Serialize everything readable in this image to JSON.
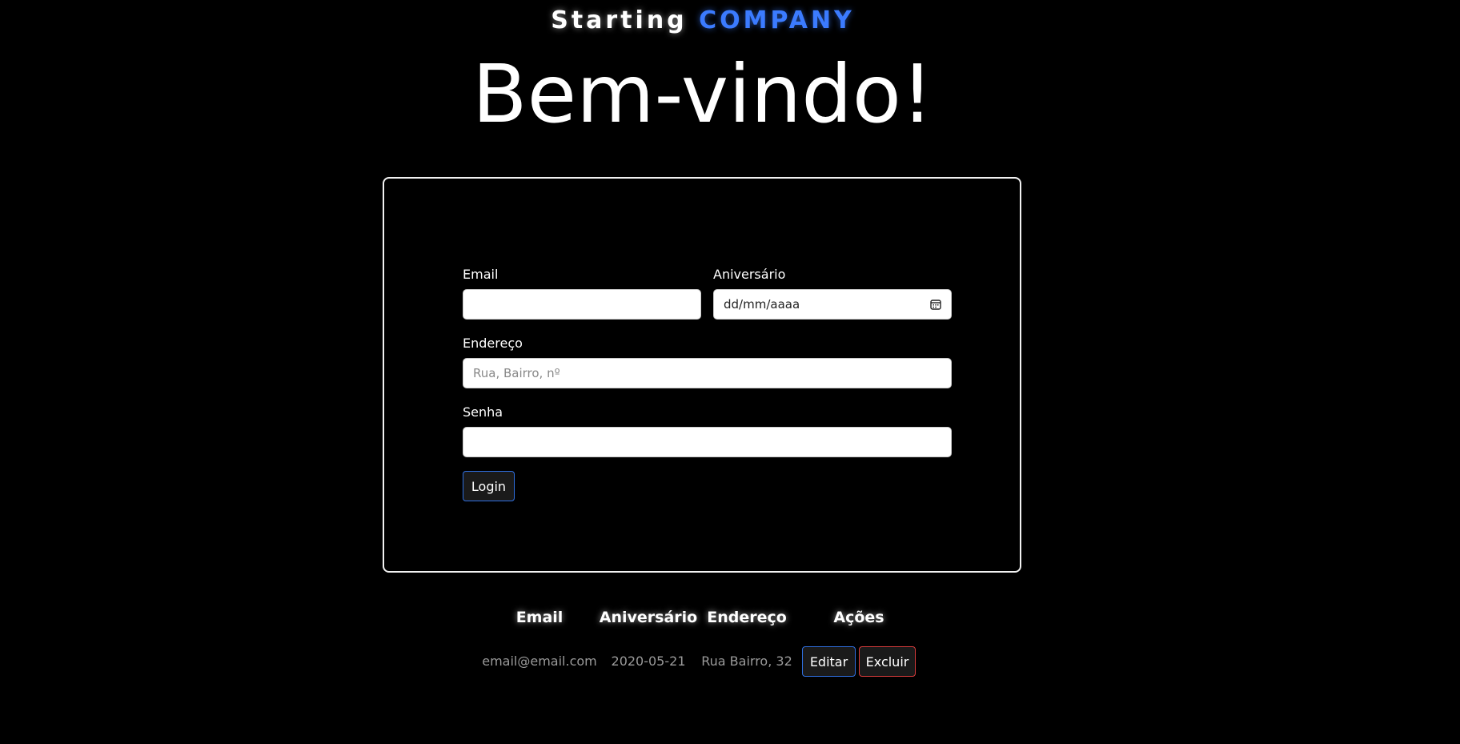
{
  "brand": {
    "word1": "Starting",
    "word2": "COMPANY",
    "accent_color": "#3b7bff"
  },
  "heading": "Bem-vindo!",
  "form": {
    "email": {
      "label": "Email",
      "value": ""
    },
    "birthday": {
      "label": "Aniversário",
      "placeholder": "dd/mm/aaaa"
    },
    "address": {
      "label": "Endereço",
      "placeholder": "Rua, Bairro, nº"
    },
    "password": {
      "label": "Senha",
      "value": ""
    },
    "login_label": "Login"
  },
  "table": {
    "headers": [
      "Email",
      "Aniversário",
      "Endereço",
      "Ações"
    ],
    "rows": [
      {
        "email": "email@email.com",
        "birthday": "2020-05-21",
        "address": "Rua Bairro, 32",
        "edit_label": "Editar",
        "delete_label": "Excluir"
      }
    ]
  }
}
